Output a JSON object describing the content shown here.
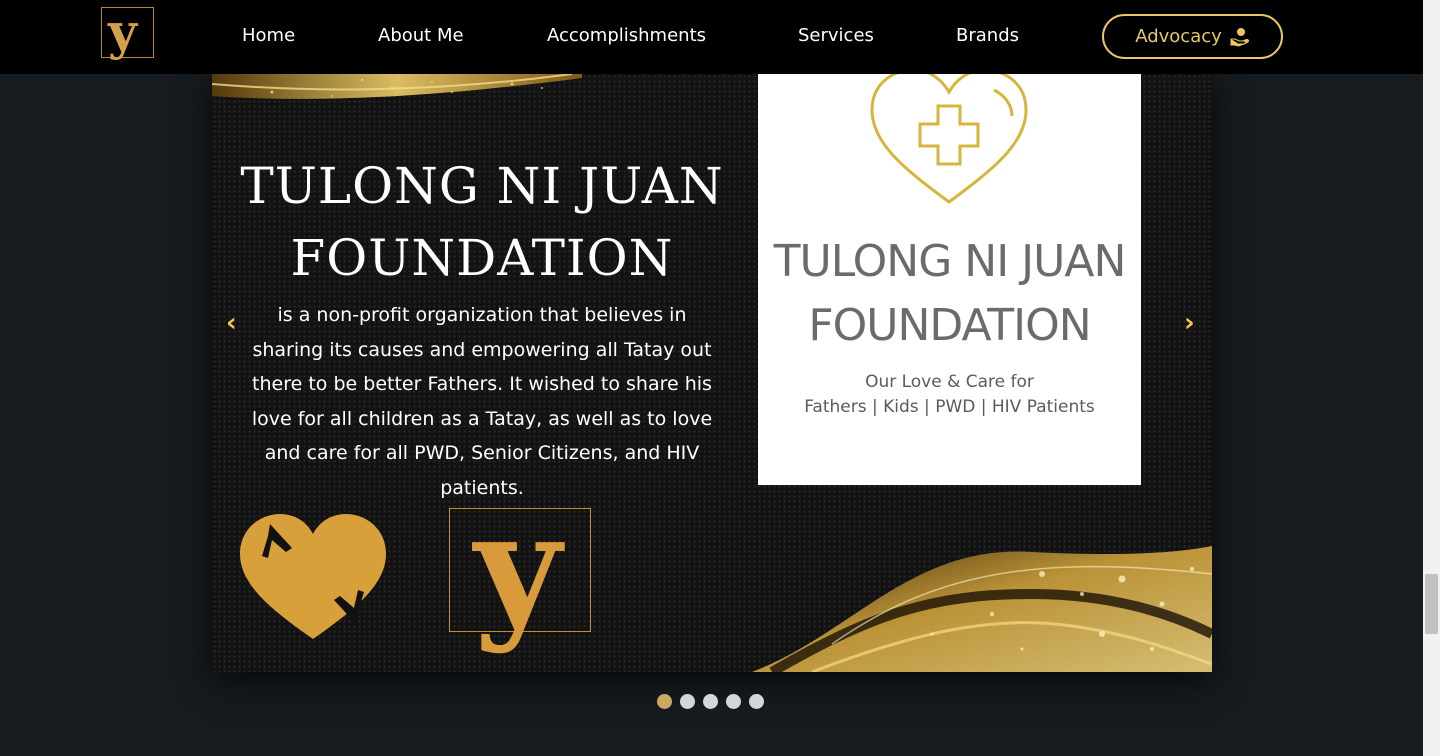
{
  "logo": {
    "letter": "y"
  },
  "nav": {
    "items": [
      {
        "label": "Home"
      },
      {
        "label": "About Me"
      },
      {
        "label": "Accomplishments"
      },
      {
        "label": "Services"
      },
      {
        "label": "Brands"
      }
    ],
    "advocacy_label": "Advocacy"
  },
  "slide": {
    "title_line1": "TULONG NI JUAN",
    "title_line2": "FOUNDATION",
    "description": "is a non-profit organization that believes in sharing its causes and empowering all Tatay out there to be better Fathers. It wished to share his love for all children as a Tatay, as well as to love and care for all PWD, Senior Citizens, and HIV patients.",
    "y_mark_letter": "y",
    "card": {
      "title_line1": "TULONG NI JUAN",
      "title_line2": "FOUNDATION",
      "sub_line1": "Our Love & Care for",
      "sub_line2": "Fathers | Kids | PWD | HIV Patients"
    },
    "prev_arrow": "‹",
    "next_arrow": "›"
  },
  "carousel": {
    "slide_count": 5,
    "active_index": 0
  },
  "colors": {
    "gold": "#e8c766",
    "gold_dark": "#c9a960",
    "nav_bg": "#000000",
    "page_bg": "#161b1f"
  },
  "icons": {
    "advocacy": "hand-holding-heart-icon",
    "prev": "chevron-left-icon",
    "next": "chevron-right-icon"
  }
}
